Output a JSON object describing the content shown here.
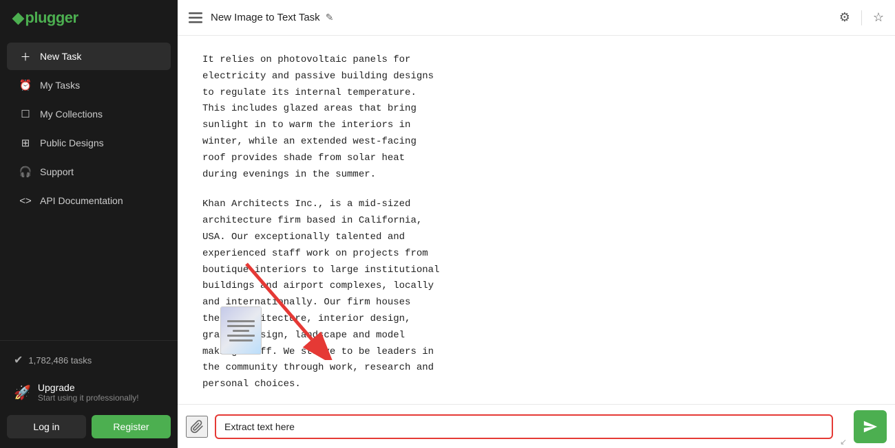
{
  "app": {
    "name": "plugger",
    "logo_accent": "p"
  },
  "sidebar": {
    "nav_items": [
      {
        "id": "new-task",
        "label": "New Task",
        "icon": "plus"
      },
      {
        "id": "my-tasks",
        "label": "My Tasks",
        "icon": "clock"
      },
      {
        "id": "my-collections",
        "label": "My Collections",
        "icon": "collection"
      },
      {
        "id": "public-designs",
        "label": "Public Designs",
        "icon": "grid"
      },
      {
        "id": "support",
        "label": "Support",
        "icon": "headphone"
      },
      {
        "id": "api-docs",
        "label": "API Documentation",
        "icon": "code"
      }
    ],
    "tasks_count": "1,782,486 tasks",
    "upgrade_title": "Upgrade",
    "upgrade_sub": "Start using it professionally!",
    "login_label": "Log in",
    "register_label": "Register"
  },
  "topbar": {
    "title": "New Image to Text Task",
    "menu_icon": "≡",
    "edit_icon": "✎",
    "settings_icon": "⚙",
    "star_icon": "☆"
  },
  "content": {
    "paragraphs": [
      "It relies on photovoltaic panels for\nelectricity and passive building designs\nto regulate its internal temperature.\nThis includes glazed areas that bring\nsunlight in to warm the interiors in\nwinter, while an extended west-facing\nroof provides shade from solar heat\nduring evenings in the summer.",
      "Khan Architects Inc., is a mid-sized\narchitecture firm based in California,\nUSA. Our exceptionally talented and\nexperienced staff work on projects from\nboutique interiors to large institutional\nbuildings and airport complexes, locally\nand internationally. Our firm houses\ntheir architecture, interior design,\ngraphic design, landscape and model\nmaking staff. We strive to be leaders in\nthe community through work, research and\npersonal choices."
    ]
  },
  "input_bar": {
    "placeholder": "Extract text here",
    "current_value": "Extract text here",
    "attach_icon": "📎",
    "send_icon": "➤"
  }
}
